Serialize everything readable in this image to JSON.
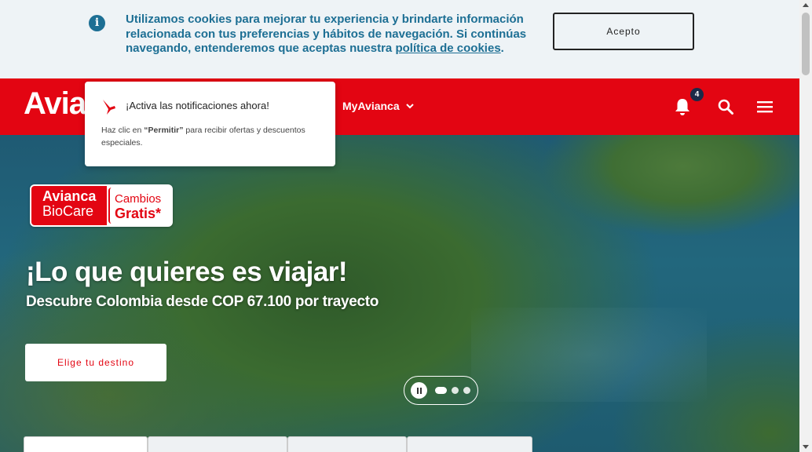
{
  "cookie_bar": {
    "text": "Utilizamos cookies para mejorar tu experiencia y brindarte información relacionada con tus preferencias y hábitos de navegación. Si continúas navegando, entenderemos que aceptas nuestra ",
    "link_text": "política de cookies",
    "suffix": ".",
    "accept_label": "Acepto",
    "info_glyph": "i"
  },
  "header": {
    "logo_text": "Avia",
    "my_avianca_label": "MyAvianca",
    "notification_count": "4",
    "icons": [
      "bell-icon",
      "search-icon",
      "hamburger-menu-icon",
      "chevron-down-icon"
    ]
  },
  "notification_popup": {
    "title": "¡Activa las notificaciones ahora!",
    "body_prefix": "Haz clic en ",
    "body_bold": "“Permitir”",
    "body_suffix": " para recibir ofertas y descuentos especiales."
  },
  "hero": {
    "badge_left_line1": "Avianca",
    "badge_left_line2": "BioCare",
    "badge_right_line1": "Cambios",
    "badge_right_line2": "Gratis*",
    "title": "¡Lo que quieres es viajar!",
    "subtitle": "Descubre Colombia desde COP 67.100 por trayecto",
    "cta_label": "Elige tu destino",
    "carousel": {
      "slides": 3,
      "active_index": 0
    }
  },
  "colors": {
    "brand_red": "#e30512",
    "cookie_text": "#1d6f94",
    "badge_navy": "#1b2a48"
  }
}
